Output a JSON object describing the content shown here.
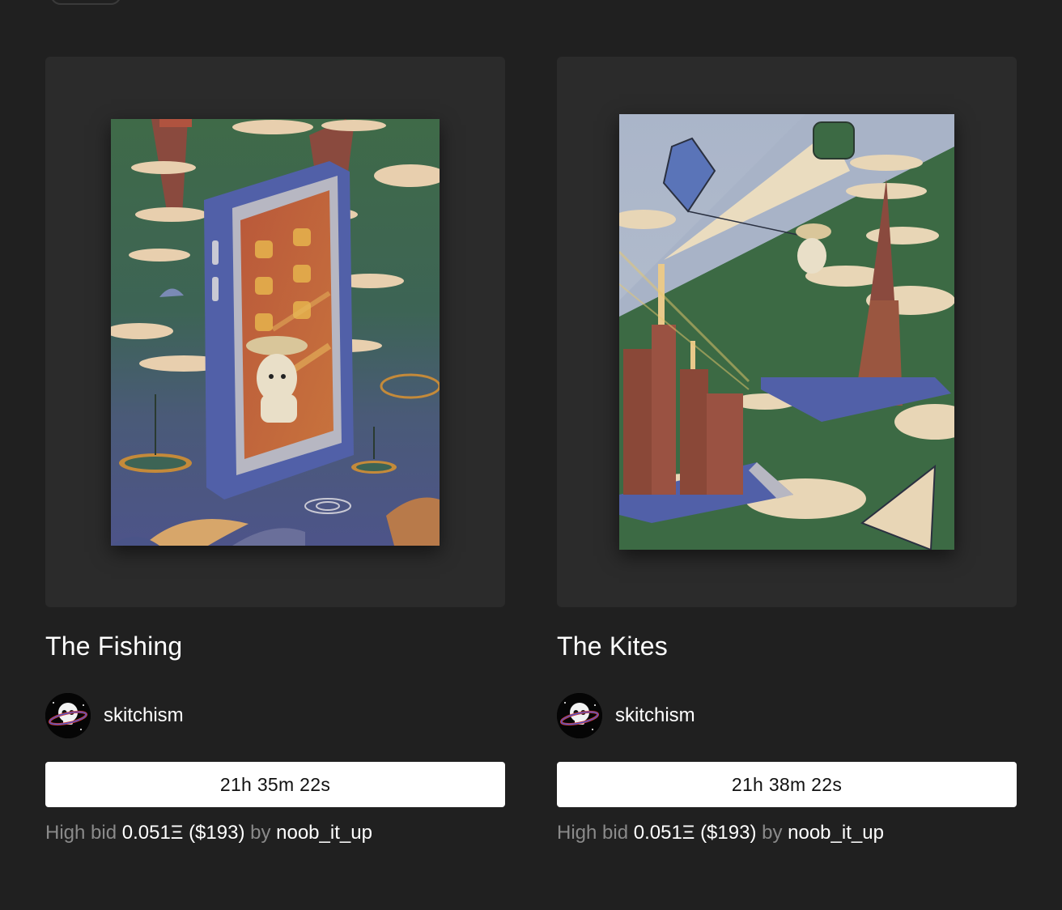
{
  "cards": [
    {
      "title": "The Fishing",
      "creator": "skitchism",
      "avatar_icon": "skull-planet-avatar",
      "timer": "21h 35m 22s",
      "bid": {
        "prefix": "High bid",
        "amount": "0.051Ξ",
        "usd": "($193)",
        "by_label": "by",
        "bidder": "noob_it_up"
      }
    },
    {
      "title": "The Kites",
      "creator": "skitchism",
      "avatar_icon": "skull-planet-avatar",
      "timer": "21h 38m 22s",
      "bid": {
        "prefix": "High bid",
        "amount": "0.051Ξ",
        "usd": "($193)",
        "by_label": "by",
        "bidder": "noob_it_up"
      }
    }
  ],
  "colors": {
    "background": "#202020",
    "card_frame": "#2b2b2b",
    "timer_bg": "#ffffff",
    "muted_text": "#8a8a8a"
  }
}
